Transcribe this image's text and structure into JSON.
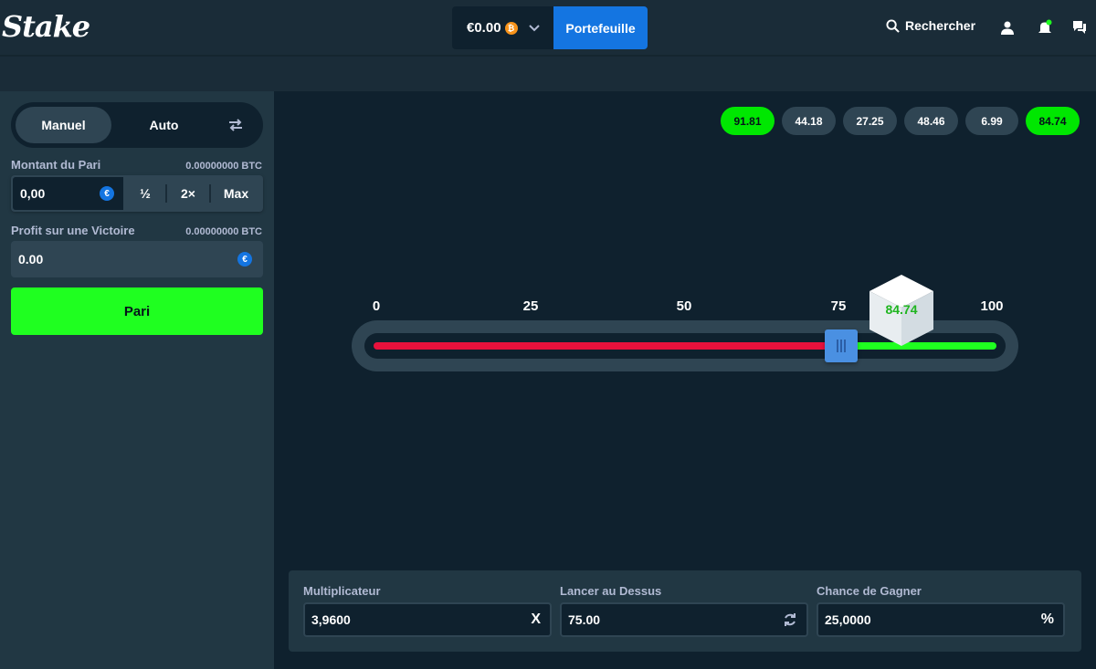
{
  "header": {
    "logo": "Stake",
    "balance": "€0.00",
    "coin_symbol": "₿",
    "wallet_label": "Portefeuille",
    "search_label": "Rechercher"
  },
  "sidebar": {
    "mode_manual": "Manuel",
    "mode_auto": "Auto",
    "bet_label": "Montant du Pari",
    "bet_crypto": "0.00000000 BTC",
    "bet_value": "0,00",
    "currency_symbol": "€",
    "half_label": "½",
    "double_label": "2×",
    "max_label": "Max",
    "profit_label": "Profit sur une Victoire",
    "profit_crypto": "0.00000000 BTC",
    "profit_value": "0.00",
    "bet_button": "Pari"
  },
  "results": [
    {
      "value": "91.81",
      "win": true
    },
    {
      "value": "44.18",
      "win": false
    },
    {
      "value": "27.25",
      "win": false
    },
    {
      "value": "48.46",
      "win": false
    },
    {
      "value": "6.99",
      "win": false
    },
    {
      "value": "84.74",
      "win": true
    }
  ],
  "slider": {
    "ticks": [
      "0",
      "25",
      "50",
      "75",
      "100"
    ],
    "value": 75,
    "roll_result": "84.74"
  },
  "controls": {
    "multiplier_label": "Multiplicateur",
    "multiplier_value": "3,9600",
    "multiplier_suffix": "X",
    "rollover_label": "Lancer au Dessus",
    "rollover_value": "75.00",
    "chance_label": "Chance de Gagner",
    "chance_value": "25,0000",
    "chance_suffix": "%"
  },
  "colors": {
    "accent_blue": "#1475e1",
    "win_green": "#1fff20",
    "lose_red": "#e9113c"
  }
}
